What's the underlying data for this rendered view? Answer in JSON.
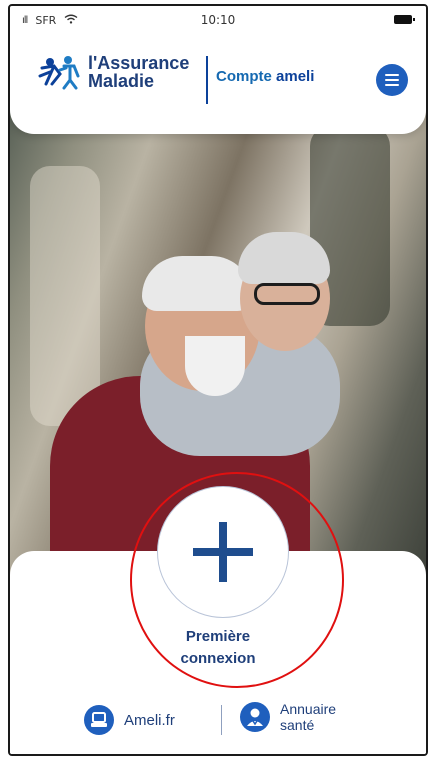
{
  "status_bar": {
    "carrier": "SFR",
    "time": "10:10",
    "signal_icon": "signal-icon",
    "wifi_icon": "wifi-icon",
    "battery_icon": "battery-icon"
  },
  "header": {
    "logo_line1": "l'Assurance",
    "logo_line2": "Maladie",
    "compte_prefix": "Compte",
    "compte_suffix": "ameli",
    "menu_icon": "menu-icon"
  },
  "main": {
    "first_login_line1": "Première",
    "first_login_line2": "connexion"
  },
  "footer_links": {
    "ameli": "Ameli.fr",
    "annuaire_line1": "Annuaire",
    "annuaire_line2": "santé"
  },
  "colors": {
    "brand_blue": "#1f5fbd",
    "dark_blue": "#0c419a",
    "highlight_red": "#e01010"
  }
}
